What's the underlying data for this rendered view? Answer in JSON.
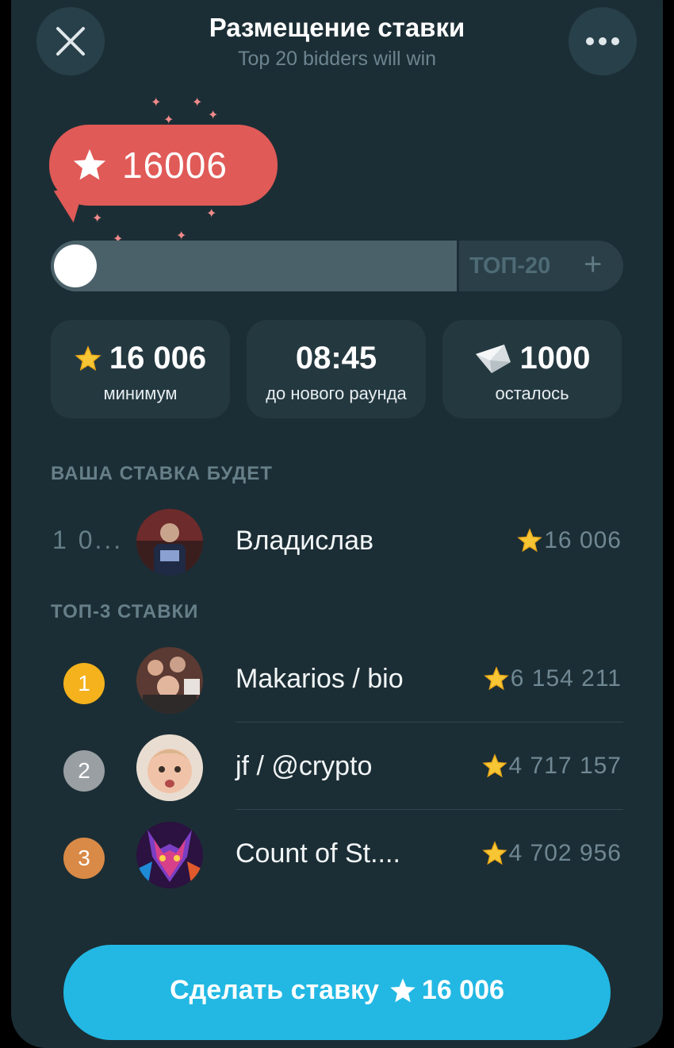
{
  "header": {
    "title": "Размещение ставки",
    "subtitle": "Top 20 bidders will win",
    "close_icon": "close-icon",
    "more_icon": "more-icon"
  },
  "bid": {
    "value": "16006",
    "star_icon": "star-icon"
  },
  "slider": {
    "level": 0.0,
    "end_label": "ТОП-20",
    "plus_icon": "plus-icon"
  },
  "stats": [
    {
      "icon": "star-icon",
      "value": "16 006",
      "label": "минимум"
    },
    {
      "icon": null,
      "value": "08:45",
      "label": "до нового раунда"
    },
    {
      "icon": "gift-icon",
      "value": "1000",
      "label": "осталось"
    }
  ],
  "your_bid": {
    "section_title": "ВАША СТАВКА БУДЕТ",
    "rank": "1 0...",
    "name": "Владислав",
    "amount": "16 006"
  },
  "top3": {
    "section_title": "ТОП-3 СТАВКИ",
    "rows": [
      {
        "rank": "1",
        "name": "Makarios / bio",
        "amount": "6 154 211",
        "medal_color": "#f5b21c"
      },
      {
        "rank": "2",
        "name": "jf / @crypto",
        "amount": "4 717 157",
        "medal_color": "#9a9fa3"
      },
      {
        "rank": "3",
        "name": "Count of St....",
        "amount": "4 702 956",
        "medal_color": "#d98a47"
      }
    ]
  },
  "cta": {
    "label": "Сделать ставку",
    "amount": "16 006"
  },
  "colors": {
    "background": "#1c2e35",
    "accent": "#22b8e3",
    "bubble": "#e05a57"
  }
}
